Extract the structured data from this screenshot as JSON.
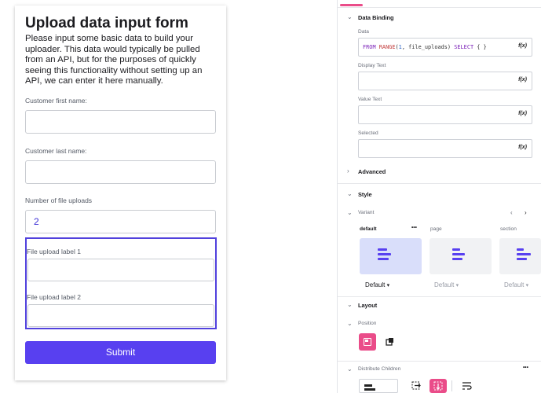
{
  "form": {
    "title": "Upload data input form",
    "description": "Please input some basic data to build your uploader. This data would typically be pulled from an API, but for the purposes of quickly seeing this functionality without setting up an API, we can enter it here manually.",
    "first_name_label": "Customer first name:",
    "first_name_value": "",
    "last_name_label": "Customer last name:",
    "last_name_value": "",
    "uploads_label": "Number of file uploads",
    "uploads_value": "2",
    "upload_labels": [
      "File upload label 1",
      "File upload label 2"
    ],
    "submit_label": "Submit"
  },
  "panel": {
    "data_binding": {
      "heading": "Data Binding",
      "data_label": "Data",
      "data_code": {
        "kw1": "FROM",
        "fn": "RANGE",
        "open": "(",
        "num": "1",
        "args": ", file_uploads)",
        "kw2": "SELECT",
        "rest": "{  }"
      },
      "display_text_label": "Display Text",
      "value_text_label": "Value Text",
      "selected_label": "Selected",
      "fx": "f(x)"
    },
    "advanced_label": "Advanced",
    "style": {
      "heading": "Style",
      "variant_label": "Variant",
      "variants": [
        {
          "name": "default",
          "select": "Default"
        },
        {
          "name": "page",
          "select": "Default"
        },
        {
          "name": "section",
          "select": "Default"
        }
      ],
      "more": "•••"
    },
    "layout": {
      "heading": "Layout",
      "position_label": "Position",
      "distribute_label": "Distribute Children",
      "more": "•••"
    }
  },
  "colors": {
    "accent": "#5840f0",
    "pink": "#ea4c89",
    "selection": "#5141dd"
  }
}
